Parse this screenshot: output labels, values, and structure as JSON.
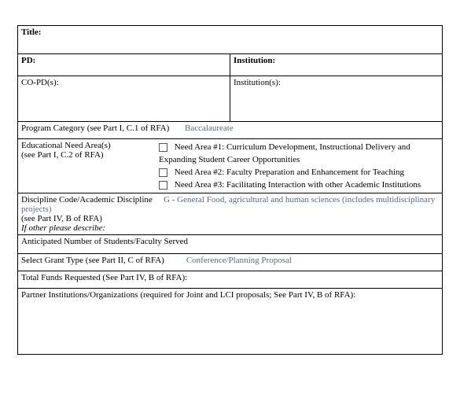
{
  "title": {
    "label": "Title:"
  },
  "pd": {
    "label": "PD:"
  },
  "institution": {
    "label": "Institution:"
  },
  "copd": {
    "label": "CO-PD(s):"
  },
  "institutions": {
    "label": "Institution(s):"
  },
  "programCategory": {
    "label": "Program Category (see Part I, C.1 of RFA)",
    "value": "Baccalaureate"
  },
  "needArea": {
    "sideLine1": "Educational Need Area(s)",
    "sideLine2": " (see Part I, C.2 of RFA)",
    "items": [
      "Need Area #1: Curriculum Development, Instructional Delivery and Expanding Student Career Opportunities",
      "Need Area #2: Faculty Preparation and Enhancement for Teaching",
      "Need Area #3: Facilitating Interaction with other Academic Institutions"
    ]
  },
  "discipline": {
    "line1": "Discipline Code/Academic Discipline",
    "line2": "(see Part IV, B of RFA)",
    "other": "If other please describe:",
    "value": "G - General Food, agricultural and human sciences (includes multidisciplinary projects)"
  },
  "anticipated": {
    "label": "Anticipated Number of Students/Faculty Served"
  },
  "grantType": {
    "label": "Select Grant Type (see Part II, C of RFA)",
    "value": "Conference/Planning Proposal"
  },
  "totalFunds": {
    "label": "Total Funds Requested (See Part IV, B of RFA):"
  },
  "partner": {
    "label": "Partner Institutions/Organizations (required for Joint and LCI proposals; See Part IV, B of RFA):"
  }
}
